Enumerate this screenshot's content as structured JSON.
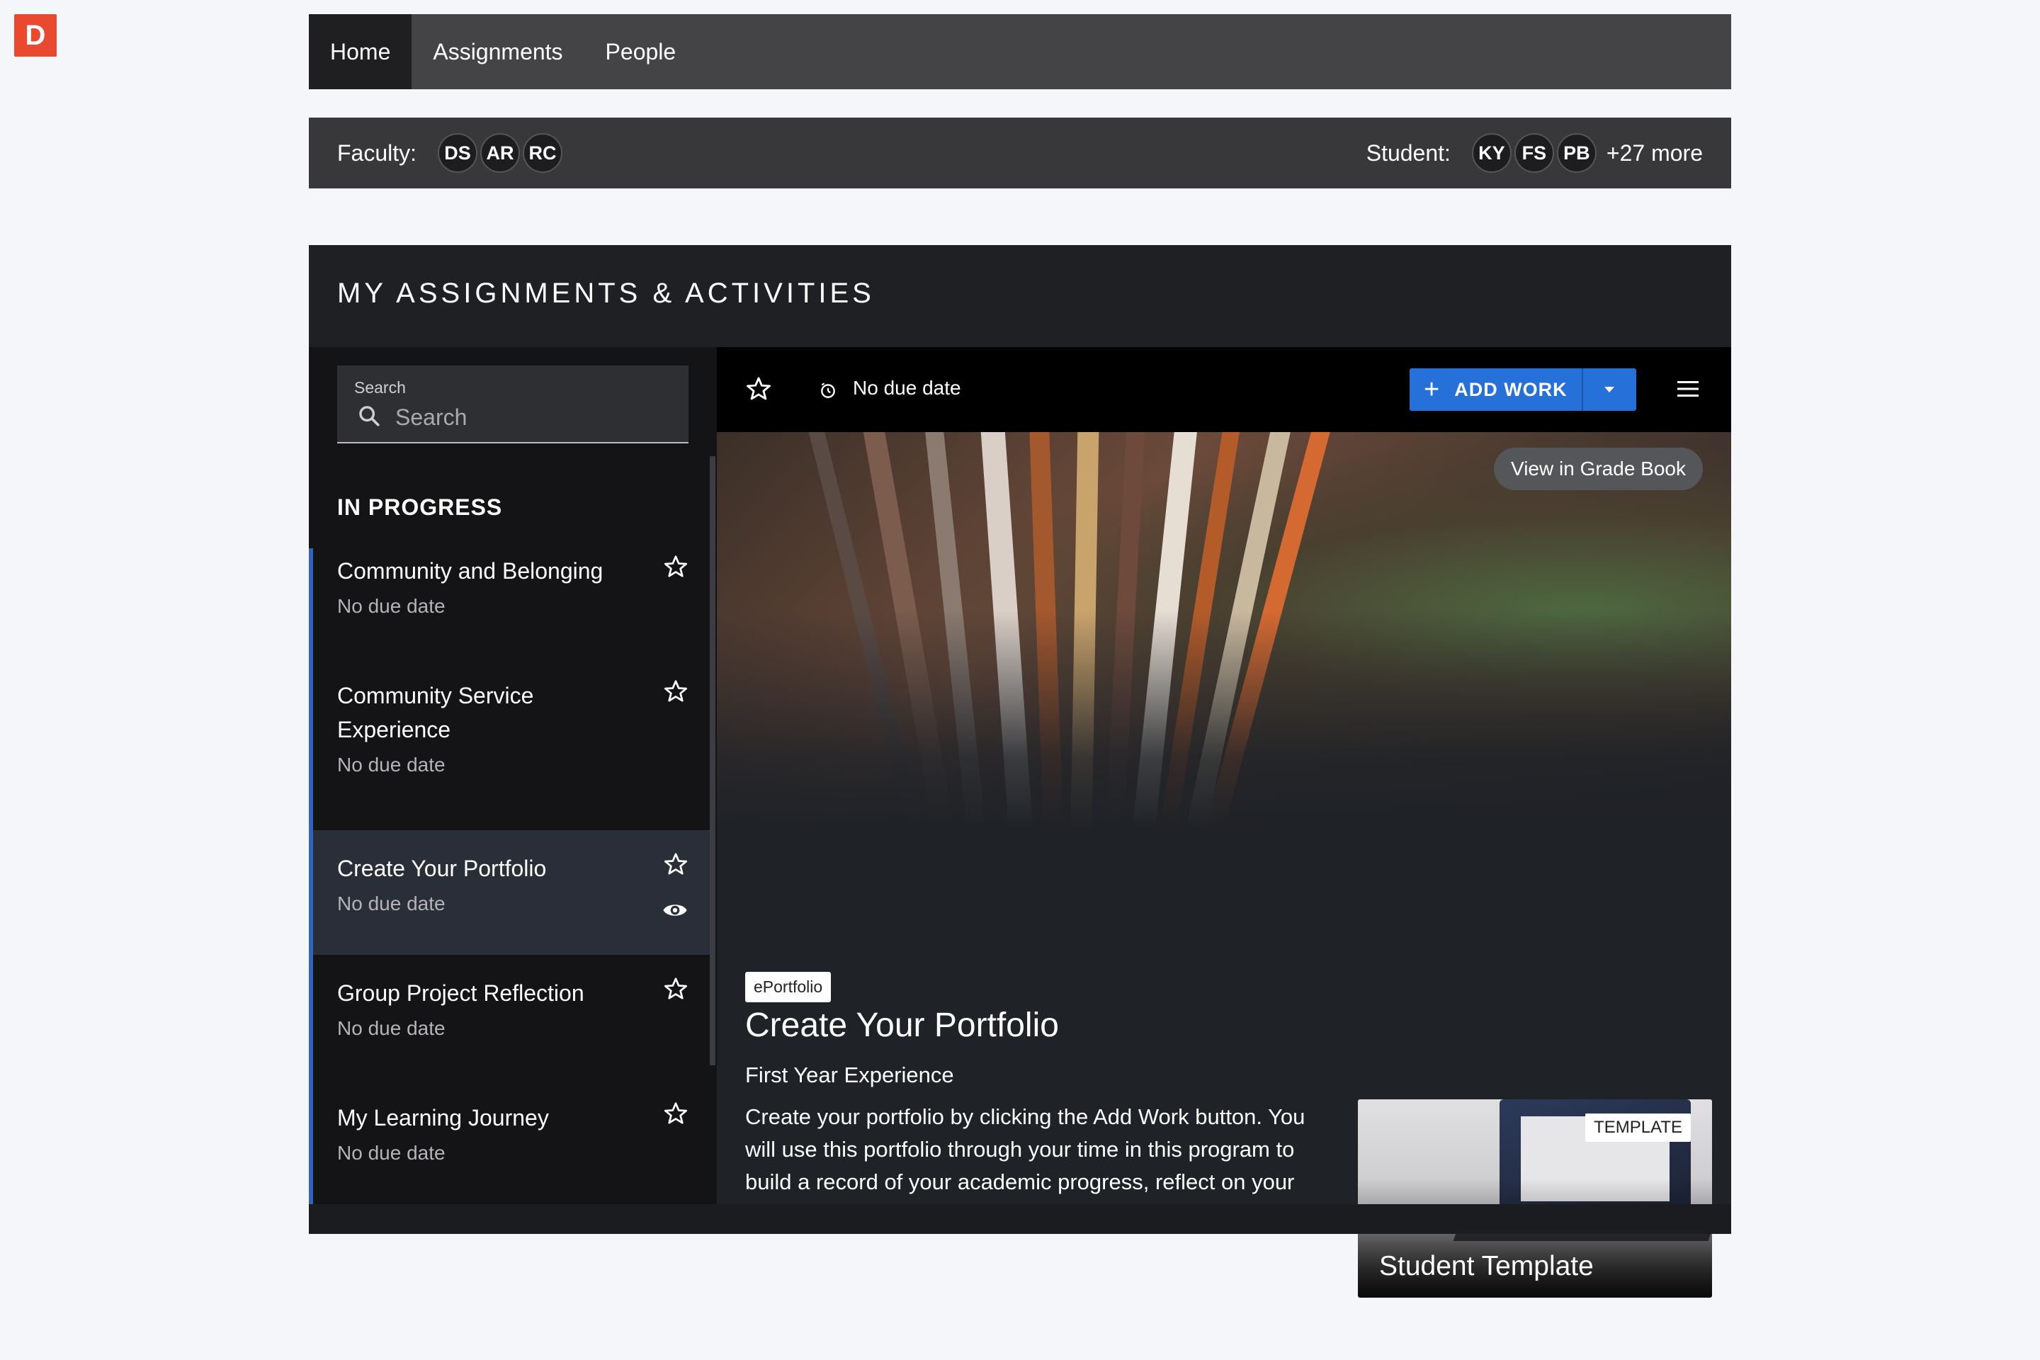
{
  "logo": {
    "letter": "D"
  },
  "nav": {
    "tabs": [
      {
        "label": "Home"
      },
      {
        "label": "Assignments"
      },
      {
        "label": "People"
      }
    ]
  },
  "roster": {
    "faculty_label": "Faculty:",
    "faculty": [
      "DS",
      "AR",
      "RC"
    ],
    "student_label": "Student:",
    "students": [
      "KY",
      "FS",
      "PB"
    ],
    "more": "+27 more"
  },
  "panel": {
    "title": "MY ASSIGNMENTS & ACTIVITIES"
  },
  "search": {
    "label": "Search",
    "placeholder": "Search"
  },
  "sidebar": {
    "section_title": "IN PROGRESS",
    "items": [
      {
        "title": "Community and Belonging",
        "due": "No due date"
      },
      {
        "title": "Community Service Experience",
        "due": "No due date"
      },
      {
        "title": "Create Your Portfolio",
        "due": "No due date"
      },
      {
        "title": "Group Project Reflection",
        "due": "No due date"
      },
      {
        "title": "My Learning Journey",
        "due": "No due date"
      }
    ]
  },
  "toolbar": {
    "due": "No due date",
    "add_work": "ADD WORK"
  },
  "hero": {
    "gradebook": "View in Grade Book"
  },
  "assignment": {
    "tag": "ePortfolio",
    "title": "Create Your Portfolio",
    "subtitle": "First Year Experience",
    "description": "Create your portfolio by clicking the Add Work button. You will use this portfolio through your time in this program to build a record of your academic progress, reflect on your academic journey, and share your work."
  },
  "template": {
    "badge": "TEMPLATE",
    "name": "Student Template"
  },
  "colors": {
    "accent": "#2671d9",
    "selected_row": "#2a2e38",
    "left_border": "#2f64b8"
  }
}
